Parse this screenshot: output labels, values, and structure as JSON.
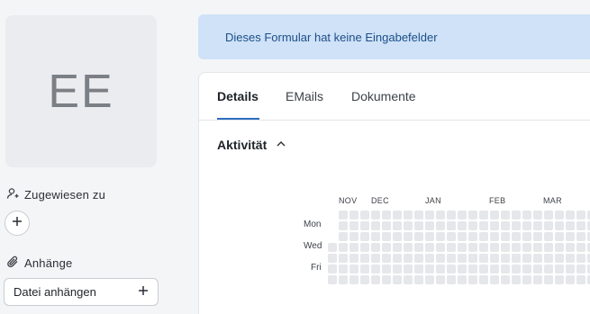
{
  "avatar": {
    "initials": "EE"
  },
  "sidebar": {
    "assigned_label": "Zugewiesen zu",
    "attachments_label": "Anhänge",
    "attach_button_label": "Datei anhängen"
  },
  "banner": {
    "text": "Dieses Formular hat keine Eingabefelder"
  },
  "tabs": [
    {
      "label": "Details",
      "active": true
    },
    {
      "label": "EMails",
      "active": false
    },
    {
      "label": "Dokumente",
      "active": false
    }
  ],
  "activity": {
    "title": "Aktivität",
    "months": [
      "NOV",
      "DEC",
      "JAN",
      "FEB",
      "MAR"
    ],
    "day_labels": [
      "Mon",
      "Wed",
      "Fri"
    ]
  },
  "colors": {
    "banner_bg": "#cfe2f7",
    "banner_text": "#1d4e89",
    "active_tab_underline": "#2f6fbf",
    "heatmap_empty": "#e6e7ea"
  }
}
